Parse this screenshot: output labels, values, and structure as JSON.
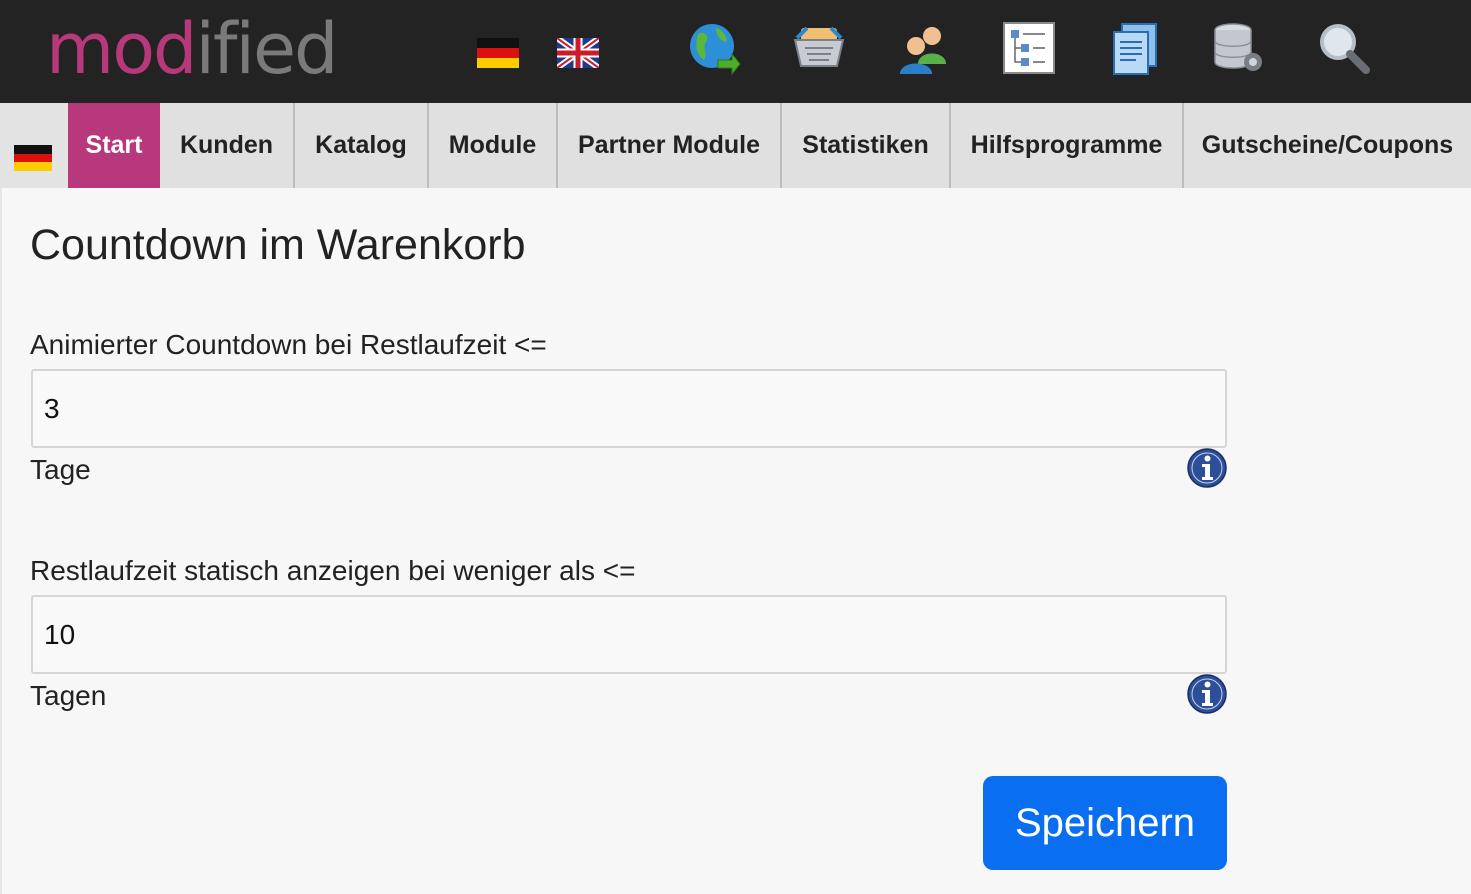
{
  "brand": {
    "logo_part1": "mod",
    "logo_part2": "ified"
  },
  "header": {
    "languages": [
      {
        "name": "Deutsch",
        "icon": "german-flag-icon"
      },
      {
        "name": "English",
        "icon": "uk-flag-icon"
      }
    ],
    "toolbar_icons": [
      "globe-icon",
      "shopping-basket-icon",
      "customers-icon",
      "category-tree-icon",
      "documents-icon",
      "database-settings-icon",
      "search-icon"
    ]
  },
  "nav": {
    "items": [
      {
        "label": "Start",
        "active": true
      },
      {
        "label": "Kunden"
      },
      {
        "label": "Katalog"
      },
      {
        "label": "Module"
      },
      {
        "label": "Partner Module"
      },
      {
        "label": "Statistiken"
      },
      {
        "label": "Hilfsprogramme"
      },
      {
        "label": "Gutscheine/Coupons"
      }
    ]
  },
  "page": {
    "title": "Countdown im Warenkorb",
    "fields": [
      {
        "label": "Animierter Countdown bei Restlaufzeit <=",
        "value": "3",
        "unit": "Tage"
      },
      {
        "label": "Restlaufzeit statisch anzeigen bei weniger als <=",
        "value": "10",
        "unit": "Tagen"
      }
    ],
    "save_label": "Speichern"
  },
  "colors": {
    "accent": "#b8387c",
    "topbar": "#232323",
    "button": "#0a6ef0",
    "info": "#2d4f9a"
  }
}
